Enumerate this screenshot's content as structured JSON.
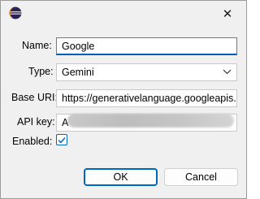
{
  "window": {
    "icon": "eclipse-icon",
    "close_glyph": "✕"
  },
  "form": {
    "name_label": "Name:",
    "name_value": "Google",
    "type_label": "Type:",
    "type_value": "Gemini",
    "base_uri_label": "Base URI:",
    "base_uri_value": "https://generativelanguage.googleapis.c",
    "api_key_label": "API key:",
    "api_key_value": "A",
    "enabled_label": "Enabled:",
    "enabled_checked": true
  },
  "buttons": {
    "ok_label": "OK",
    "cancel_label": "Cancel"
  },
  "colors": {
    "accent": "#005fb8",
    "checkbox_accent": "#0067c0",
    "dialog_bg": "#f0f0f0"
  }
}
